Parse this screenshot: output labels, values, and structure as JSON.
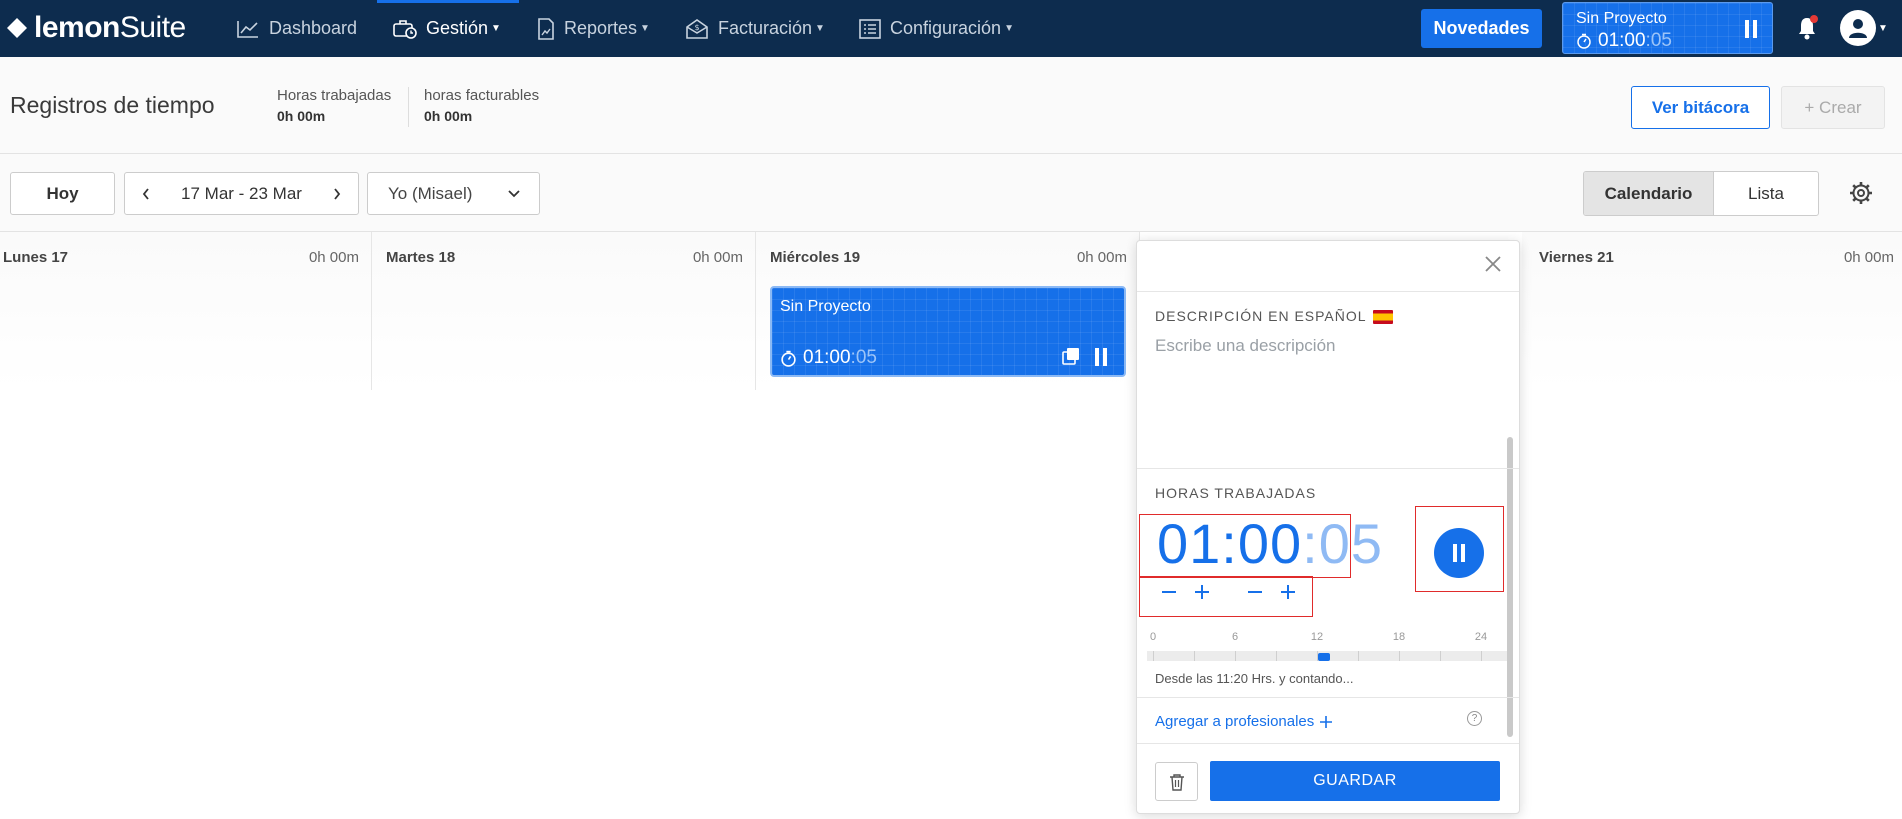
{
  "brand": {
    "logo_bold": "lemon",
    "logo_light": "Suite"
  },
  "nav": {
    "items": [
      {
        "label": "Dashboard",
        "icon": "chart-line-icon"
      },
      {
        "label": "Gestión",
        "icon": "briefcase-clock-icon"
      },
      {
        "label": "Reportes",
        "icon": "report-document-icon"
      },
      {
        "label": "Facturación",
        "icon": "invoice-envelope-icon"
      },
      {
        "label": "Configuración",
        "icon": "settings-list-icon"
      }
    ],
    "novedades": "Novedades",
    "timer": {
      "project": "Sin Proyecto",
      "time_main": "01:00",
      "time_sec": ":05"
    }
  },
  "header": {
    "title": "Registros de tiempo",
    "stats": [
      {
        "label": "Horas trabajadas",
        "value": "0h 00m"
      },
      {
        "label": "horas facturables",
        "value": "0h 00m"
      }
    ],
    "view_log": "Ver bitácora",
    "create": "+ Crear"
  },
  "toolbar": {
    "today": "Hoy",
    "week_range": "17 Mar - 23 Mar",
    "user": "Yo (Misael)",
    "views": [
      "Calendario",
      "Lista"
    ]
  },
  "calendar": {
    "days": [
      {
        "name": "Lunes 17",
        "hours": "0h 00m"
      },
      {
        "name": "Martes 18",
        "hours": "0h 00m"
      },
      {
        "name": "Miércoles 19",
        "hours": "0h 00m"
      },
      {
        "name": "Viernes 21",
        "hours": "0h 00m"
      }
    ],
    "entry": {
      "project": "Sin Proyecto",
      "time_main": "01:00",
      "time_sec": ":05"
    }
  },
  "popup": {
    "description_label": "DESCRIPCIÓN EN ESPAÑOL",
    "description_placeholder": "Escribe una descripción",
    "hours_label": "HORAS TRABAJADAS",
    "time_main": "01:00",
    "time_sec": ":05",
    "scale": [
      "0",
      "6",
      "12",
      "18",
      "24"
    ],
    "since_text": "Desde las 11:20 Hrs. y contando...",
    "add_professionals": "Agregar a profesionales",
    "save": "GUARDAR"
  },
  "colors": {
    "nav_bg": "#0d2c4e",
    "accent": "#1670e9",
    "highlight": "#e02b2b"
  }
}
